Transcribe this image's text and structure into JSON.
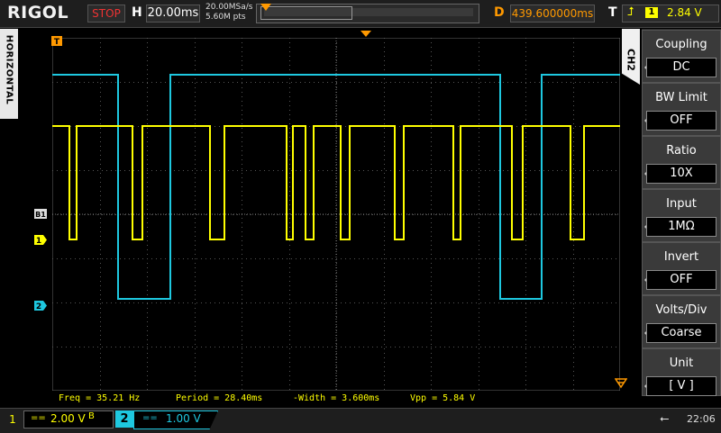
{
  "topbar": {
    "brand": "RIGOL",
    "run_state": "STOP",
    "horizontal_label": "H",
    "timebase": "20.00ms",
    "sample_rate": "20.00MSa/s",
    "memory_depth": "5.60M pts",
    "delay_label": "D",
    "delay_value": "439.600000ms",
    "trigger_label": "T",
    "trigger_source": "1",
    "trigger_level": "2.84 V"
  },
  "side_tab": {
    "label": "HORIZONTAL"
  },
  "markers": {
    "trigger_top": "T",
    "ref_b1": "B1",
    "ch1": "1",
    "ch2": "2"
  },
  "menu": {
    "channel_tab": "CH2",
    "items": [
      {
        "label": "Coupling",
        "value": "DC"
      },
      {
        "label": "BW Limit",
        "value": "OFF"
      },
      {
        "label": "Ratio",
        "value": "10X"
      },
      {
        "label": "Input",
        "value": "1MΩ"
      },
      {
        "label": "Invert",
        "value": "OFF"
      },
      {
        "label": "Volts/Div",
        "value": "Coarse"
      },
      {
        "label": "Unit",
        "value": "[ V ]"
      }
    ]
  },
  "measurements": [
    "Freq = 35.21 Hz",
    "Period = 28.40ms",
    "-Width = 3.600ms",
    "Vpp = 5.84 V"
  ],
  "bottombar": {
    "ch1_num": "1",
    "ch1_coupling": "==",
    "ch1_scale": "2.00 V",
    "ch1_bw": "B",
    "ch2_num": "2",
    "ch2_coupling": "==",
    "ch2_scale": "1.00 V",
    "time": "22:06"
  },
  "colors": {
    "ch1": "#ffff00",
    "ch2": "#1ec8e0",
    "trigger": "#ff9900",
    "grid": "#555555"
  }
}
